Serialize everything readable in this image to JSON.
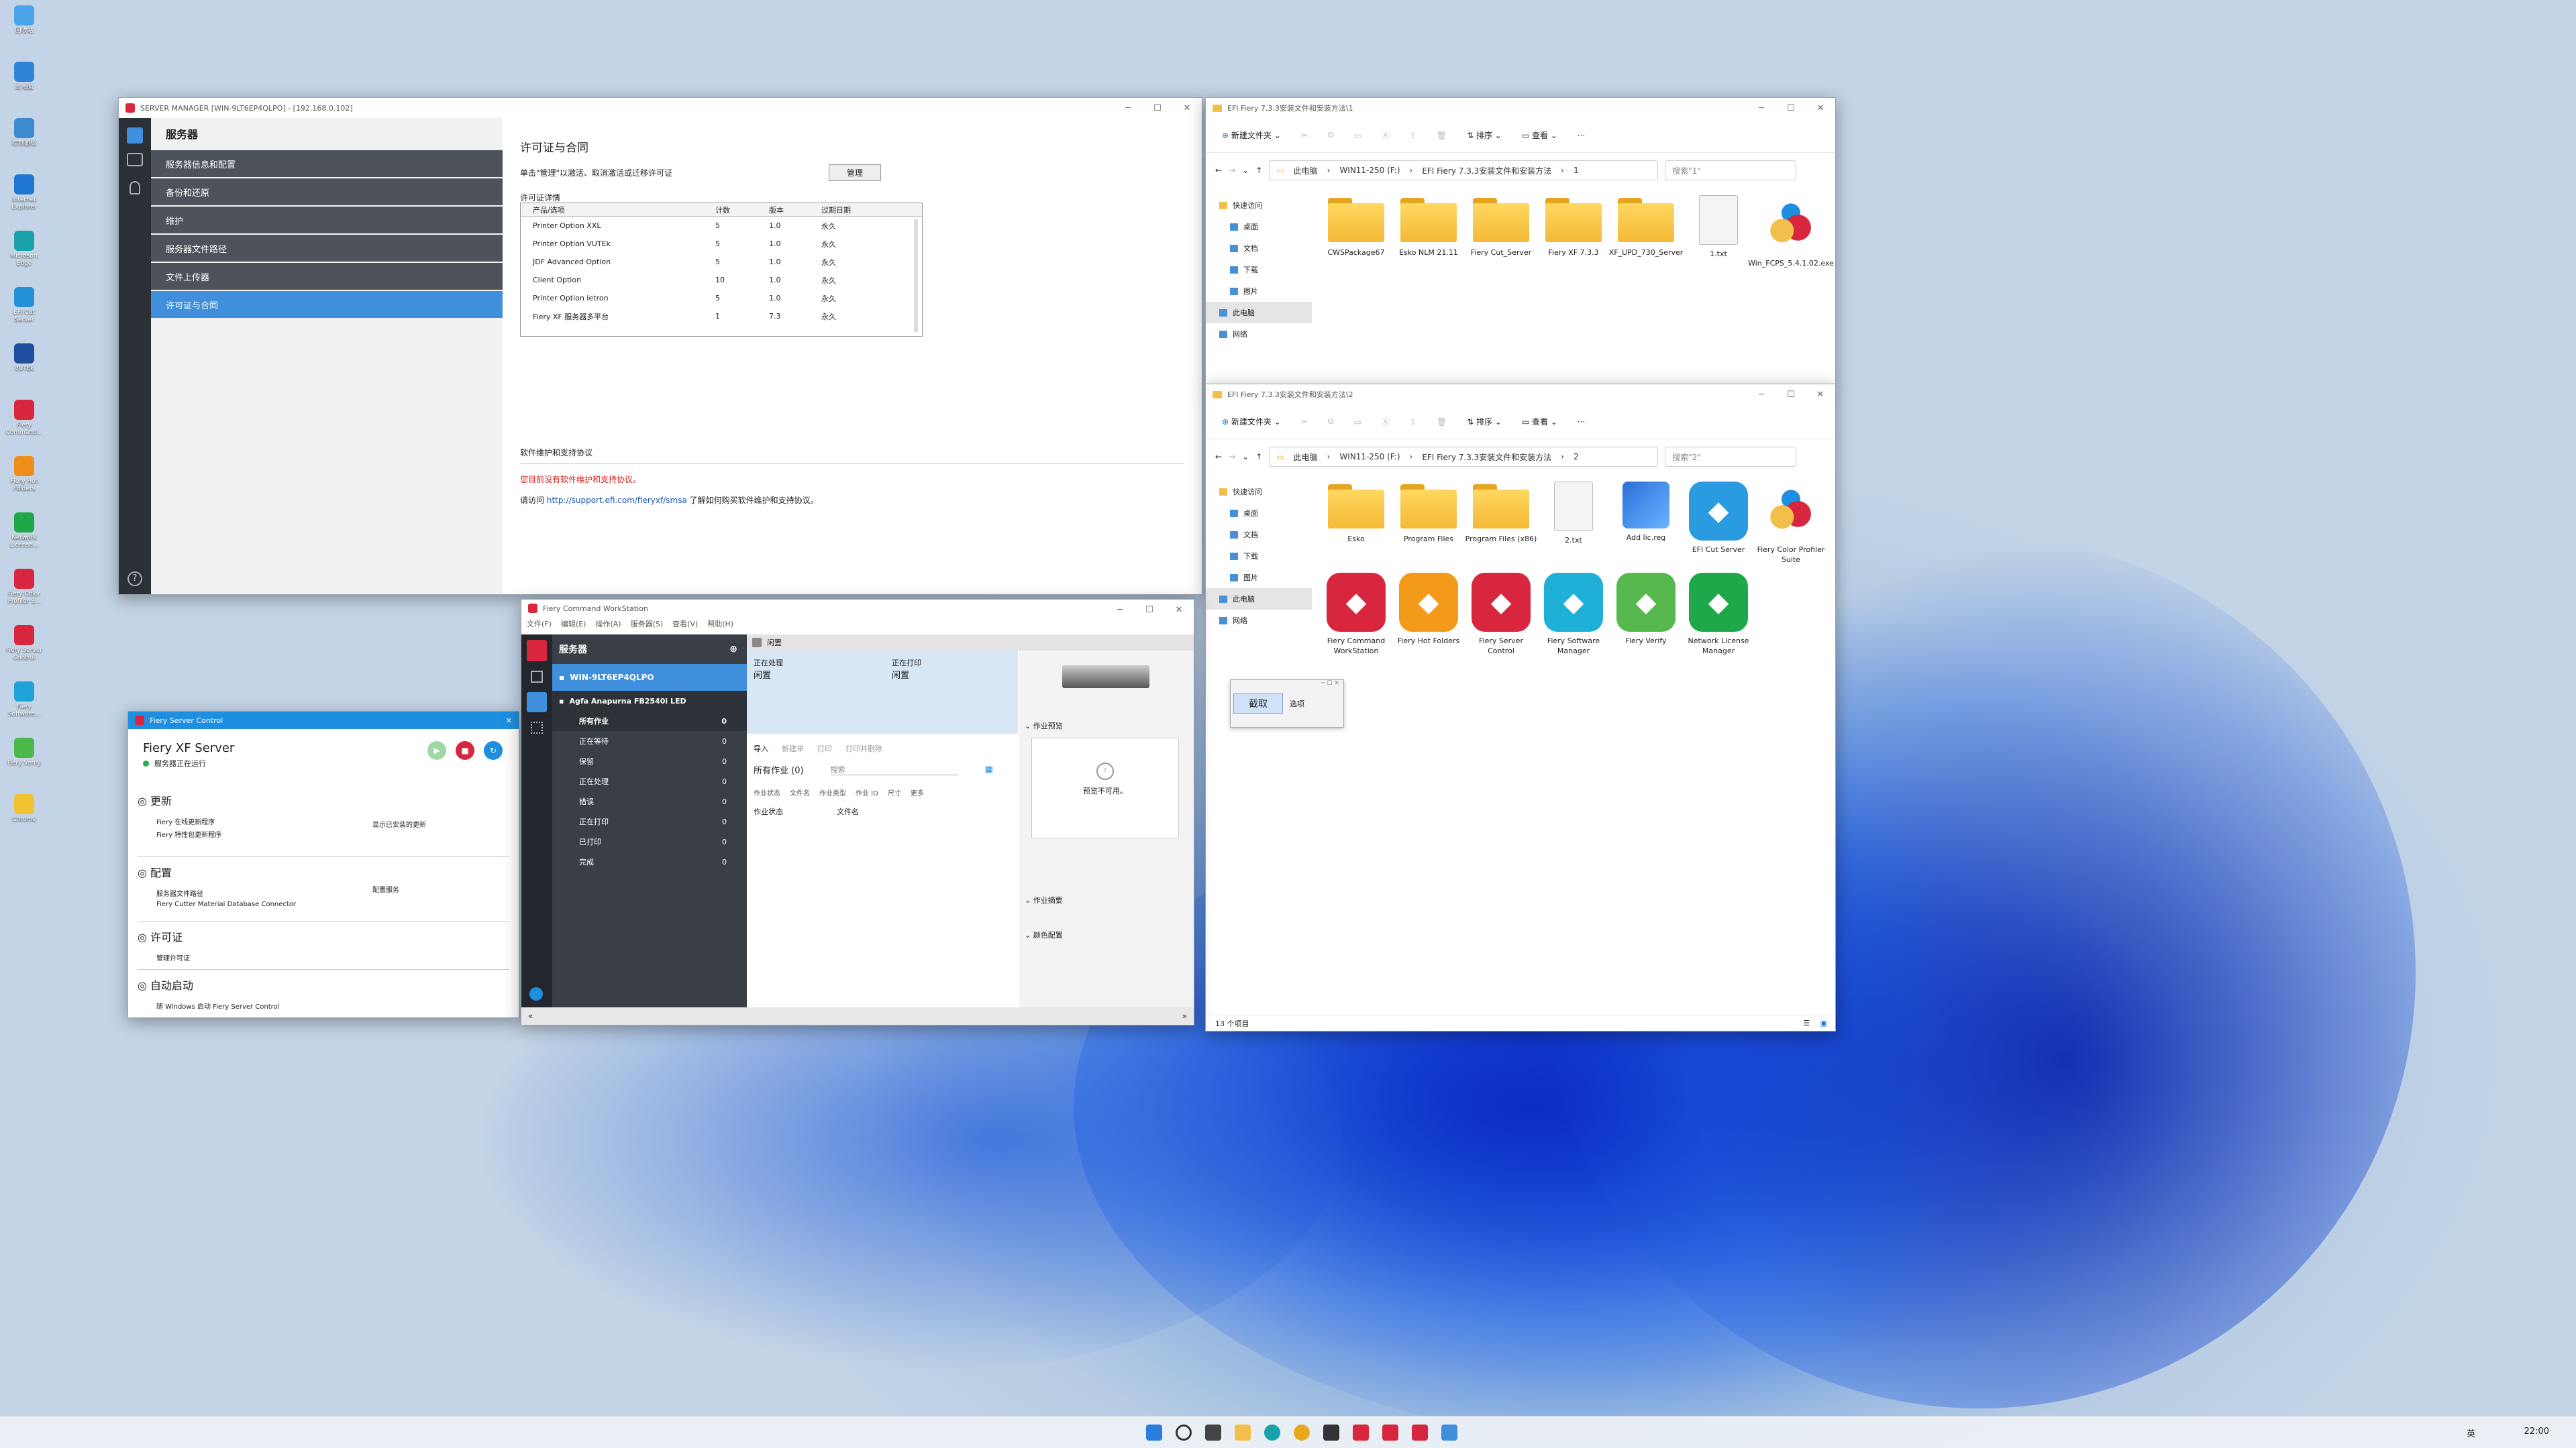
{
  "desktop_icons": [
    {
      "label": "回收站",
      "color": "#4aa3e8",
      "icon": "recycle-bin-icon"
    },
    {
      "label": "此电脑",
      "color": "#2d84d8",
      "icon": "computer-icon"
    },
    {
      "label": "控制面板",
      "color": "#3d8ad0",
      "icon": "control-panel-icon"
    },
    {
      "label": "Internet Explorer",
      "color": "#1f76d2",
      "icon": "ie-icon"
    },
    {
      "label": "Microsoft Edge",
      "color": "#1aa0a8",
      "icon": "edge-icon"
    },
    {
      "label": "EFI Cut Server",
      "color": "#2390d8",
      "icon": "efi-cut-server-icon"
    },
    {
      "label": "VUTEk",
      "color": "#1f4f9c",
      "icon": "vutek-icon"
    },
    {
      "label": "Fiery Command...",
      "color": "#d7263d",
      "icon": "fiery-cws-icon"
    },
    {
      "label": "Fiery Hot Folders",
      "color": "#f08c1a",
      "icon": "hot-folders-icon"
    },
    {
      "label": "Network License...",
      "color": "#1fa84a",
      "icon": "network-license-icon"
    },
    {
      "label": "Fiery Color Profiler S...",
      "color": "#d7263d",
      "icon": "color-profiler-icon"
    },
    {
      "label": "Fiery Server Control",
      "color": "#d7263d",
      "icon": "server-control-icon"
    },
    {
      "label": "Fiery Software...",
      "color": "#1fa3d8",
      "icon": "software-manager-icon"
    },
    {
      "label": "Fiery Verify",
      "color": "#4cb84a",
      "icon": "verify-icon"
    },
    {
      "label": "Chrome",
      "color": "#f2c230",
      "icon": "chrome-icon"
    }
  ],
  "server_manager": {
    "title": "SERVER MANAGER [WIN-9LT6EP4QLPO] - [192.168.0.102]",
    "nav_head": "服务器",
    "nav_items": [
      "服务器信息和配置",
      "备份和还原",
      "维护",
      "服务器文件路径",
      "文件上传器",
      "许可证与合同"
    ],
    "page_title": "许可证与合同",
    "manage_hint": "单击\"管理\"以激活、取消激活或迁移许可证",
    "manage_button": "管理",
    "details_label": "许可证详情",
    "table_headers": [
      "产品/选项",
      "计数",
      "版本",
      "过期日期"
    ],
    "table_rows": [
      [
        "Printer Option XXL",
        "5",
        "1.0",
        "永久"
      ],
      [
        "Printer Option VUTEk",
        "5",
        "1.0",
        "永久"
      ],
      [
        "JDF Advanced Option",
        "5",
        "1.0",
        "永久"
      ],
      [
        "Client Option",
        "10",
        "1.0",
        "永久"
      ],
      [
        "Printer Option Ietron",
        "5",
        "1.0",
        "永久"
      ],
      [
        "Fiery XF 服务器多平台",
        "1",
        "7.3",
        "永久"
      ]
    ],
    "support_label": "软件维护和支持协议",
    "support_warning": "您目前没有软件维护和支持协议。",
    "support_visit_prefix": "请访问",
    "support_link": "http://support.efi.com/fieryxf/smsa",
    "support_visit_suffix": "了解如何购买软件维护和支持协议。"
  },
  "explorer1": {
    "title": "EFI Fiery 7.3.3安装文件和安装方法\\1",
    "new_label": "新建文件夹",
    "sort_label": "排序",
    "view_label": "查看",
    "breadcrumb": [
      "此电脑",
      "WIN11-250 (F:)",
      "EFI Fiery 7.3.3安装文件和安装方法",
      "1"
    ],
    "search_placeholder": "搜索\"1\"",
    "tree": [
      "快速访问",
      "桌面",
      "文档",
      "下载",
      "图片",
      "此电脑",
      "网络"
    ],
    "files": [
      {
        "name": "CWSPackage67",
        "type": "folder"
      },
      {
        "name": "Esko NLM 21.11",
        "type": "folder"
      },
      {
        "name": "Fiery Cut_Server",
        "type": "folder"
      },
      {
        "name": "Fiery XF 7.3.3",
        "type": "folder"
      },
      {
        "name": "XF_UPD_730_Server",
        "type": "folder"
      },
      {
        "name": "1.txt",
        "type": "doc"
      },
      {
        "name": "Win_FCPS_5.4.1.02.exe",
        "type": "drops"
      }
    ]
  },
  "explorer2": {
    "title": "EFI Fiery 7.3.3安装文件和安装方法\\2",
    "new_label": "新建文件夹",
    "sort_label": "排序",
    "view_label": "查看",
    "breadcrumb": [
      "此电脑",
      "WIN11-250 (F:)",
      "EFI Fiery 7.3.3安装文件和安装方法",
      "2"
    ],
    "search_placeholder": "搜索\"2\"",
    "tree": [
      "快速访问",
      "桌面",
      "文档",
      "下载",
      "图片",
      "此电脑",
      "网络"
    ],
    "files": [
      {
        "name": "Esko",
        "type": "folder"
      },
      {
        "name": "Program Files",
        "type": "folder"
      },
      {
        "name": "Program Files (x86)",
        "type": "folder"
      },
      {
        "name": "2.txt",
        "type": "doc"
      },
      {
        "name": "Add lic.reg",
        "type": "reg"
      },
      {
        "name": "EFI Cut Server",
        "type": "app",
        "color": "#2a9be0"
      },
      {
        "name": "Fiery Color Profiler Suite",
        "type": "drops"
      },
      {
        "name": "Fiery Command WorkStation",
        "type": "app",
        "color": "#d7263d"
      },
      {
        "name": "Fiery Hot Folders",
        "type": "app",
        "color": "#f39a1b"
      },
      {
        "name": "Fiery Server Control",
        "type": "app",
        "color": "#d7263d"
      },
      {
        "name": "Fiery Software Manager",
        "type": "app",
        "color": "#1fb0d8"
      },
      {
        "name": "Fiery Verify",
        "type": "app",
        "color": "#57b94d"
      },
      {
        "name": "Network License Manager",
        "type": "app",
        "color": "#1fa84a"
      }
    ],
    "status": "13 个项目",
    "snip_button": "截取",
    "snip_option": "选项"
  },
  "server_control": {
    "title": "Fiery Server Control",
    "server_name": "Fiery XF Server",
    "server_status": "服务器正在运行",
    "sections": [
      {
        "title": "更新",
        "lines": [
          "Fiery 在线更新程序",
          "Fiery 特性包更新程序"
        ],
        "right": "显示已安装的更新"
      },
      {
        "title": "配置",
        "lines": [
          "服务器文件路径",
          "Fiery Cutter Material Database Connector"
        ],
        "right": "配置服务"
      },
      {
        "title": "许可证",
        "lines": [
          "管理许可证"
        ],
        "right": ""
      },
      {
        "title": "自动启动",
        "lines": [
          "随 Windows 启动 Fiery Server Control"
        ],
        "right": ""
      }
    ]
  },
  "cws": {
    "title": "Fiery Command WorkStation",
    "menu": [
      "文件(F)",
      "编辑(E)",
      "操作(A)",
      "服务器(S)",
      "查看(V)",
      "帮助(H)"
    ],
    "servers_label": "服务器",
    "server_name": "WIN-9LT6EP4QLPO",
    "printer_name": "Agfa Anapurna FB2540i LED",
    "queues": [
      {
        "label": "所有作业",
        "count": "0"
      },
      {
        "label": "正在等待",
        "count": "0"
      },
      {
        "label": "保留",
        "count": "0"
      },
      {
        "label": "正在处理",
        "count": "0"
      },
      {
        "label": "错误",
        "count": "0"
      },
      {
        "label": "正在打印",
        "count": "0"
      },
      {
        "label": "已打印",
        "count": "0"
      },
      {
        "label": "完成",
        "count": "0"
      }
    ],
    "status_bar": "闲置",
    "processing_label": "正在处理",
    "processing_state": "闲置",
    "printing_label": "正在打印",
    "printing_state": "闲置",
    "actions": [
      "导入",
      "新建单",
      "打印",
      "打印并删除"
    ],
    "jobs_title": "所有作业 (0)",
    "search_placeholder": "搜索",
    "filters": [
      "作业状态",
      "文件名",
      "作业类型",
      "作业 ID",
      "尺寸",
      "更多"
    ],
    "columns": [
      "作业状态",
      "文件名"
    ],
    "preview_section": "作业预览",
    "preview_unavailable": "预览不可用。",
    "summary_section": "作业摘要",
    "color_section": "颜色配置"
  },
  "taskbar": {
    "clock": "22:00",
    "lang": "英"
  }
}
